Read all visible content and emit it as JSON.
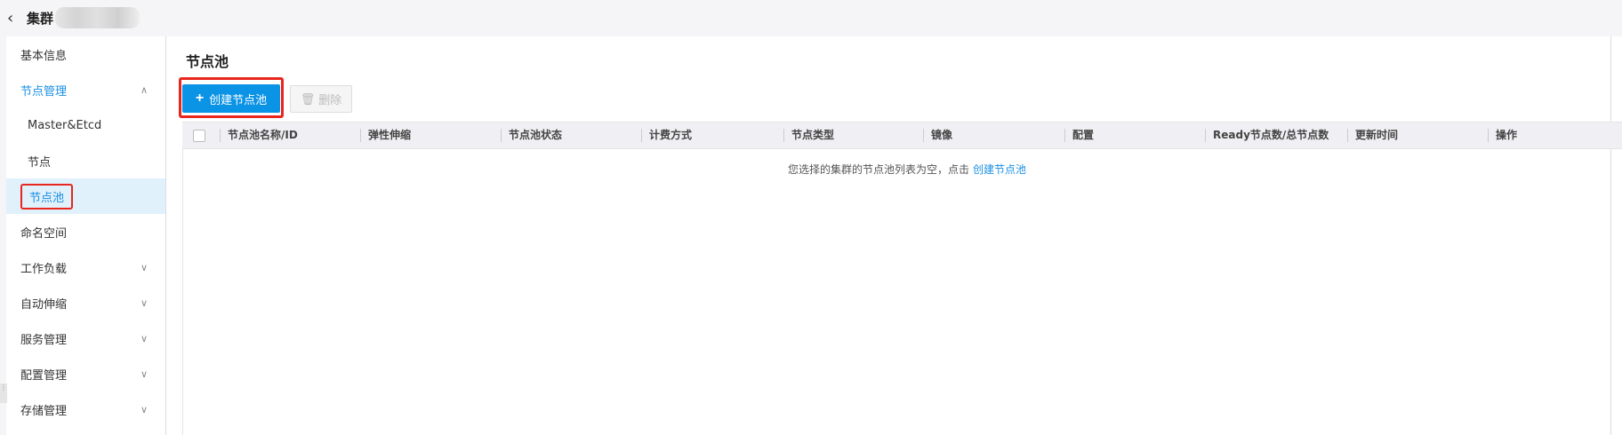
{
  "header": {
    "back_icon": "chevron-left-icon",
    "title": "集群"
  },
  "sidebar": {
    "items": [
      {
        "label": "基本信息"
      },
      {
        "label": "节点管理",
        "icon": "chevron-up-icon"
      },
      {
        "label": "Master&Etcd"
      },
      {
        "label": "节点"
      },
      {
        "label": "节点池"
      },
      {
        "label": "命名空间"
      },
      {
        "label": "工作负载",
        "icon": "chevron-down-icon"
      },
      {
        "label": "自动伸缩",
        "icon": "chevron-down-icon"
      },
      {
        "label": "服务管理",
        "icon": "chevron-down-icon"
      },
      {
        "label": "配置管理",
        "icon": "chevron-down-icon"
      },
      {
        "label": "存储管理",
        "icon": "chevron-down-icon"
      }
    ]
  },
  "main": {
    "title": "节点池",
    "create_label": "创建节点池",
    "delete_label": "删除",
    "columns": [
      "节点池名称/ID",
      "弹性伸缩",
      "节点池状态",
      "计费方式",
      "节点类型",
      "镜像",
      "配置",
      "Ready节点数/总节点数",
      "更新时间",
      "操作"
    ],
    "empty_text": "您选择的集群的节点池列表为空，点击",
    "empty_link": "创建节点池"
  },
  "colors": {
    "accent": "#0b93e6",
    "highlight": "#e8261e"
  }
}
